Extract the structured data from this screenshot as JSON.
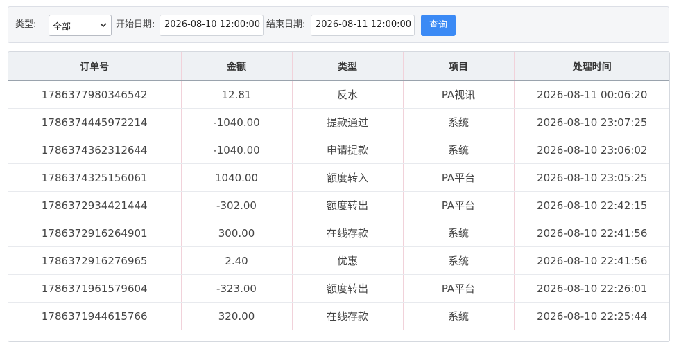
{
  "filters": {
    "type_label": "类型:",
    "type_value": "全部",
    "start_label": "开始日期:",
    "start_value": "2026-08-10 12:00:00",
    "end_label": "结束日期:",
    "end_value": "2026-08-11 12:00:00",
    "search_label": "查询"
  },
  "table": {
    "headers": [
      "订单号",
      "金额",
      "类型",
      "项目",
      "处理时间"
    ],
    "rows": [
      [
        "1786377980346542",
        "12.81",
        "反水",
        "PA视讯",
        "2026-08-11 00:06:20"
      ],
      [
        "1786374445972214",
        "-1040.00",
        "提款通过",
        "系统",
        "2026-08-10 23:07:25"
      ],
      [
        "1786374362312644",
        "-1040.00",
        "申请提款",
        "系统",
        "2026-08-10 23:06:02"
      ],
      [
        "1786374325156061",
        "1040.00",
        "额度转入",
        "PA平台",
        "2026-08-10 23:05:25"
      ],
      [
        "1786372934421444",
        "-302.00",
        "额度转出",
        "PA平台",
        "2026-08-10 22:42:15"
      ],
      [
        "1786372916264901",
        "300.00",
        "在线存款",
        "系统",
        "2026-08-10 22:41:56"
      ],
      [
        "1786372916276965",
        "2.40",
        "优惠",
        "系统",
        "2026-08-10 22:41:56"
      ],
      [
        "1786371961579604",
        "-323.00",
        "额度转出",
        "PA平台",
        "2026-08-10 22:26:01"
      ],
      [
        "1786371944615766",
        "320.00",
        "在线存款",
        "系统",
        "2026-08-10 22:25:44"
      ]
    ]
  },
  "colors": {
    "accent": "#3b8af5",
    "header_bg": "#eef1f4",
    "column_divider": "#f1d2da"
  }
}
